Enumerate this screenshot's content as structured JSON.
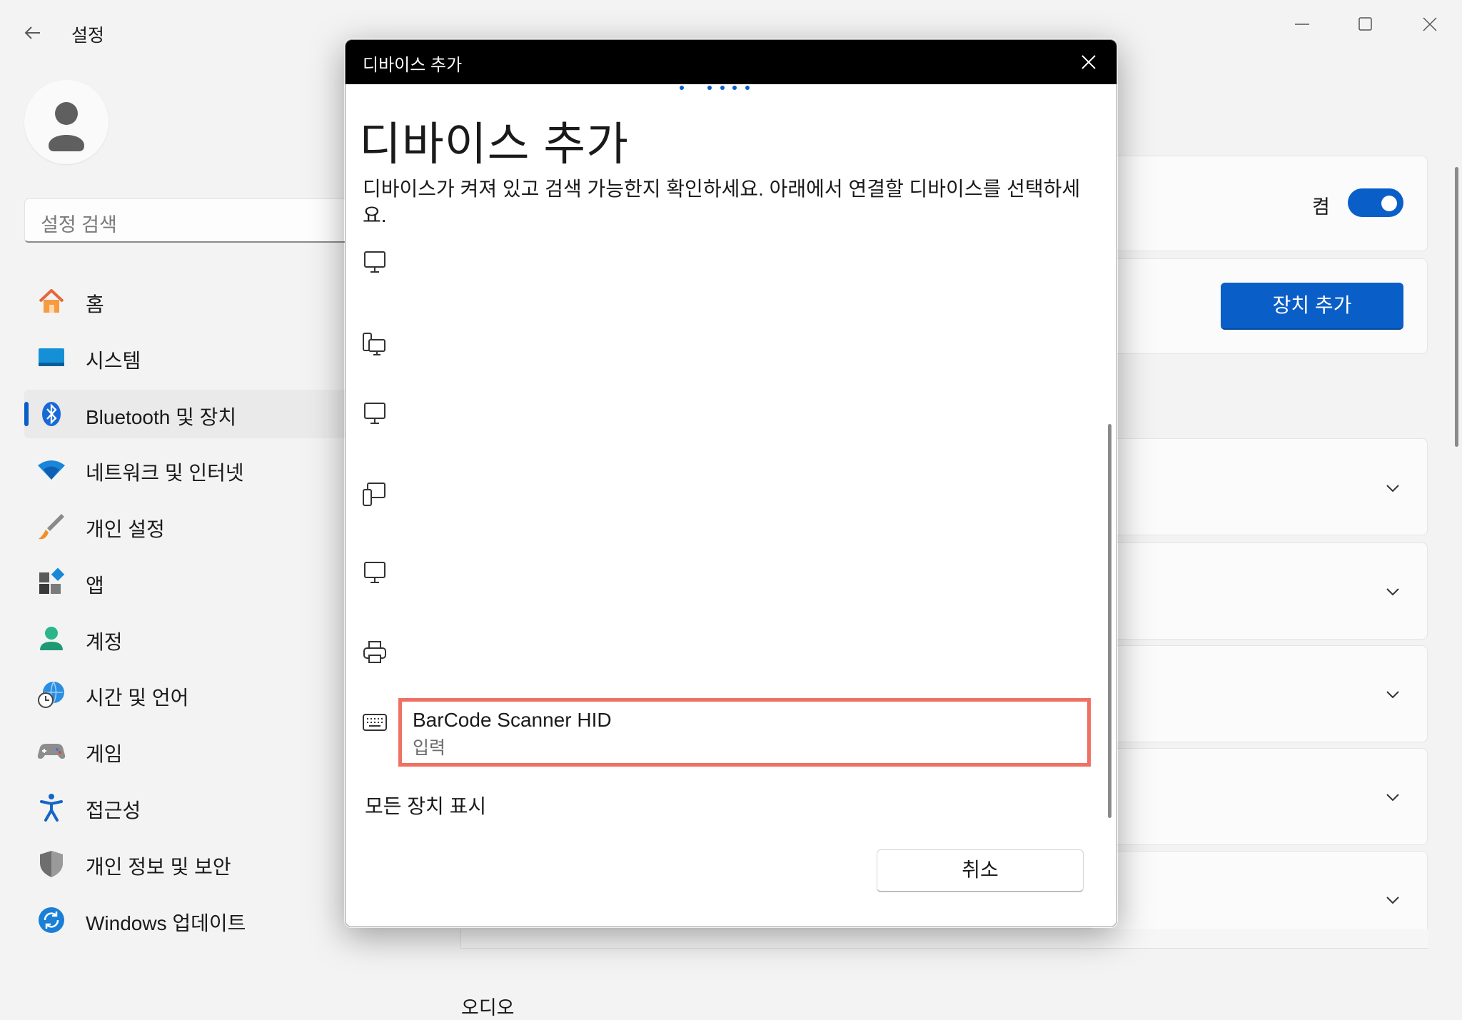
{
  "window": {
    "app_title": "설정"
  },
  "sidebar": {
    "search_placeholder": "설정 검색",
    "items": [
      {
        "label": "홈",
        "icon": "home-icon"
      },
      {
        "label": "시스템",
        "icon": "system-icon"
      },
      {
        "label": "Bluetooth 및 장치",
        "icon": "bluetooth-icon",
        "active": true
      },
      {
        "label": "네트워크 및 인터넷",
        "icon": "wifi-icon"
      },
      {
        "label": "개인 설정",
        "icon": "brush-icon"
      },
      {
        "label": "앱",
        "icon": "apps-icon"
      },
      {
        "label": "계정",
        "icon": "account-icon"
      },
      {
        "label": "시간 및 언어",
        "icon": "globe-clock-icon"
      },
      {
        "label": "게임",
        "icon": "gamepad-icon"
      },
      {
        "label": "접근성",
        "icon": "accessibility-icon"
      },
      {
        "label": "개인 정보 및 보안",
        "icon": "shield-icon"
      },
      {
        "label": "Windows 업데이트",
        "icon": "update-icon"
      }
    ]
  },
  "main": {
    "bluetooth_toggle_label": "켬",
    "bluetooth_on": true,
    "add_device_button": "장치 추가",
    "bottom_section_label": "오디오"
  },
  "dialog": {
    "titlebar": "디바이스 추가",
    "heading": "디바이스 추가",
    "description": "디바이스가 켜져 있고 검색 가능한지 확인하세요. 아래에서 연결할 디바이스를 선택하세요.",
    "devices": [
      {
        "icon": "monitor-icon"
      },
      {
        "icon": "phone-desktop-icon"
      },
      {
        "icon": "monitor-icon"
      },
      {
        "icon": "phone-monitor-icon"
      },
      {
        "icon": "monitor-icon"
      },
      {
        "icon": "printer-icon"
      },
      {
        "icon": "keyboard-icon",
        "name": "BarCode Scanner HID",
        "type": "입력"
      }
    ],
    "show_all": "모든 장치 표시",
    "cancel_button": "취소"
  },
  "colors": {
    "accent": "#0a5ec8",
    "highlight_border": "#ee7163"
  }
}
